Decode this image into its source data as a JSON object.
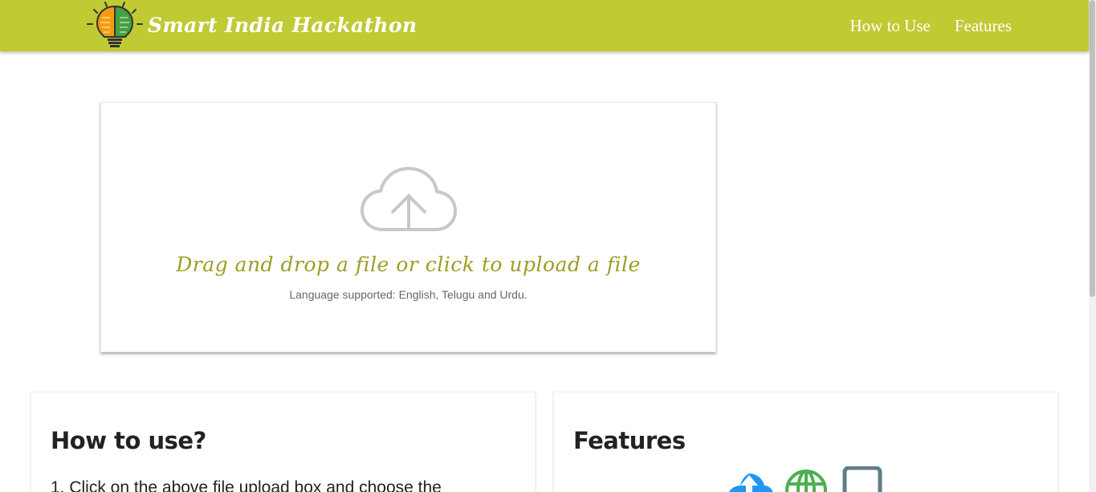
{
  "navbar": {
    "brand_text": "Smart India Hackathon",
    "links": [
      "How to Use",
      "Features"
    ]
  },
  "upload": {
    "icon": "cloud-upload-icon",
    "title": "Drag and drop a file or click to upload a file",
    "subtitle": "Language supported: English, Telugu and Urdu."
  },
  "howto": {
    "title": "How to use?",
    "step_1": "1. Click on the above file upload box and choose the"
  },
  "features": {
    "title": "Features",
    "icons": [
      "cloud-upload-icon",
      "globe-icon",
      "tablet-icon"
    ]
  },
  "colors": {
    "navbar": "#c0ca33",
    "upload_title": "#9e9d24",
    "cloud_icon": "#c8c8c8",
    "feature_cloud": "#2196f3",
    "feature_globe": "#4caf50",
    "feature_tablet": "#607d8b"
  }
}
